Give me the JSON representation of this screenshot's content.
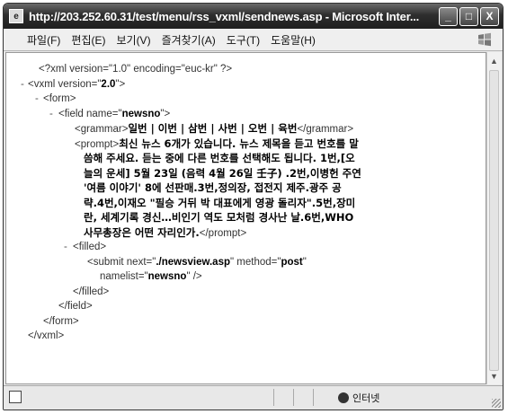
{
  "window": {
    "title": "http://203.252.60.31/test/menu/rss_vxml/sendnews.asp - Microsoft Inter...",
    "buttons": {
      "minimize": "_",
      "maximize": "□",
      "close": "X"
    }
  },
  "menu": [
    "파일(F)",
    "편집(E)",
    "보기(V)",
    "즐겨찾기(A)",
    "도구(T)",
    "도움말(H)"
  ],
  "xml": {
    "decl": "<?xml version=\"1.0\" encoding=\"euc-kr\" ?>",
    "vxml_open_pre": "<vxml version=\"",
    "vxml_version": "2.0",
    "vxml_open_post": "\">",
    "form_open": "<form>",
    "field_open_pre": "<field name=\"",
    "field_name": "newsno",
    "field_open_post": "\">",
    "grammar_open": "<grammar>",
    "grammar_text": "일번 | 이번 | 삼번 | 사번 | 오번 | 육번",
    "grammar_close": "</grammar>",
    "prompt_open": "<prompt>",
    "prompt_lines": [
      "최신 뉴스 6개가 있습니다. 뉴스 제목을 듣고 번호를 말",
      "씀해 주세요. 듣는 중에 다른 번호를 선택해도 됩니다. 1번,[오",
      "늘의 운세] 5월 23일 (음력 4월 26일 壬子) .2번,이병헌 주연",
      "'여름 이야기' 8에 선판매.3번,정의장, 접전지 제주.광주 공",
      "략.4번,이재오 \"필승 거뒤 박 대표에게 영광 돌리자\".5번,장미",
      "란, 세계기록 경신…비인기 역도 모처럼 경사난 날.6번,WHO",
      "사무총장은 어떤 자리인가."
    ],
    "prompt_close": "</prompt>",
    "filled_open": "<filled>",
    "submit_pre": "<submit next=\"",
    "submit_next": "./newsview.asp",
    "submit_mid": "\" method=\"",
    "submit_method": "post",
    "submit_end": "\"",
    "namelist_pre": "namelist=\"",
    "namelist_value": "newsno",
    "namelist_post": "\" />",
    "filled_close": "</filled>",
    "field_close": "</field>",
    "form_close": "</form>",
    "vxml_close": "</vxml>",
    "minus": "-"
  },
  "status": {
    "zone": "인터넷"
  },
  "icons": [
    "ie-page-icon",
    "minimize-icon",
    "maximize-icon",
    "close-icon",
    "windows-logo-icon",
    "scroll-up-icon",
    "scroll-down-icon",
    "status-page-icon",
    "globe-icon"
  ]
}
